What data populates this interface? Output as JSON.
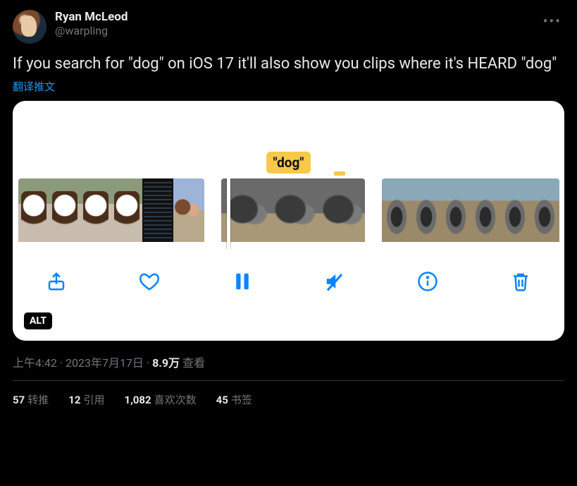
{
  "author": {
    "display_name": "Ryan McLeod",
    "handle": "@warpling"
  },
  "tweet_text": "If you search for \"dog\" on iOS 17 it'll also show you clips where it's HEARD \"dog\"",
  "translate_label": "翻译推文",
  "media": {
    "search_term": "\"dog\"",
    "alt_badge": "ALT"
  },
  "meta": {
    "time": "上午4:42",
    "date": "2023年7月17日",
    "views_number": "8.9万",
    "views_label": "查看"
  },
  "stats": {
    "retweets": {
      "count": "57",
      "label": "转推"
    },
    "quotes": {
      "count": "12",
      "label": "引用"
    },
    "likes": {
      "count": "1,082",
      "label": "喜欢次数"
    },
    "bookmarks": {
      "count": "45",
      "label": "书签"
    }
  }
}
